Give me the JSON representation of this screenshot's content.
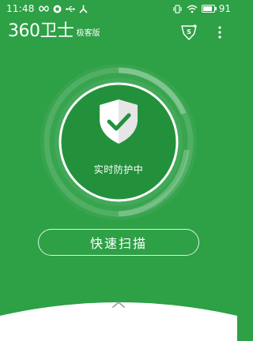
{
  "status_bar": {
    "time": "11:48",
    "battery_level": "91",
    "battery_fraction": 0.91,
    "left_icons": [
      "infinity-icon",
      "record-icon",
      "usb-icon",
      "network-icon"
    ],
    "right_icons": [
      "vibrate-icon",
      "wifi-icon",
      "battery-icon"
    ]
  },
  "header": {
    "logo_text": "360卫士",
    "logo_edition": "极客版",
    "shield_icon": "shield-s-icon",
    "menu_icon": "more-vert-icon"
  },
  "protection": {
    "status": "实时防护中",
    "icon": "shield-check-icon"
  },
  "actions": {
    "scan_label": "快速扫描"
  },
  "bottom": {
    "handle_icon": "chevron-up-icon"
  },
  "colors": {
    "background": "#2ea046",
    "inner_circle": "#23913c",
    "sheet": "#ffffff",
    "handle": "#9aa0a6"
  }
}
